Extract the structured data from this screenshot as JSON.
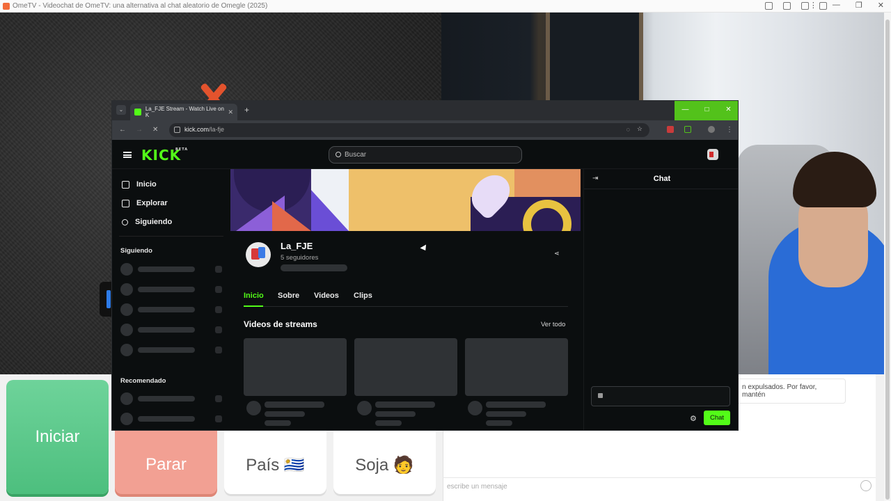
{
  "outer_browser": {
    "tab_title": "OmeTV - Videochat de OmeTV: una alternativa al chat aleatorio de Omegle (2025)"
  },
  "omegle_controls": {
    "start_label": "Iniciar",
    "stop_label": "Parar",
    "country_label": "País 🇺🇾",
    "soja_label": "Soja 🧑"
  },
  "omegle_chat": {
    "message_text": "n expulsados. Por favor, mantén",
    "input_placeholder": "escribe un mensaje"
  },
  "kick_window": {
    "tab_title": "La_FJE Stream - Watch Live on K",
    "url_domain": "kick.com",
    "url_path": "/la-fje"
  },
  "kick": {
    "logo": "KICK",
    "logo_badge": "BETA",
    "search_placeholder": "Buscar",
    "nav": [
      {
        "label": "Inicio"
      },
      {
        "label": "Explorar"
      },
      {
        "label": "Siguiendo"
      }
    ],
    "following_heading": "Siguiendo",
    "recommended_heading": "Recomendado",
    "channel": {
      "name": "La_FJE",
      "followers": "5 seguidores"
    },
    "tabs": [
      {
        "label": "Inicio",
        "active": true
      },
      {
        "label": "Sobre",
        "active": false
      },
      {
        "label": "Videos",
        "active": false
      },
      {
        "label": "Clips",
        "active": false
      }
    ],
    "section_title": "Videos de streams",
    "see_all": "Ver todo",
    "chat_title": "Chat",
    "chat_button": "Chat",
    "accent_color": "#53fc18"
  }
}
